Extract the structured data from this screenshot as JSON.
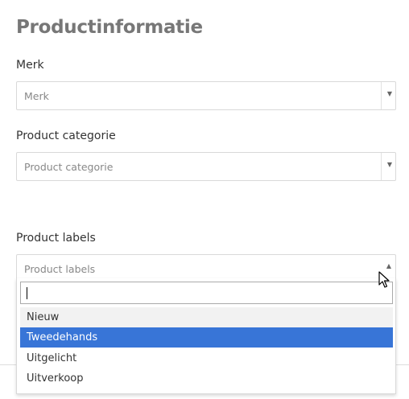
{
  "page": {
    "title": "Productinformatie"
  },
  "fields": {
    "brand": {
      "label": "Merk",
      "placeholder": "Merk"
    },
    "category": {
      "label": "Product categorie",
      "placeholder": "Product categorie"
    },
    "labels": {
      "label": "Product labels",
      "placeholder": "Product labels"
    }
  },
  "dropdown": {
    "search_value": "",
    "options": [
      "Nieuw",
      "Tweedehands",
      "Uitgelicht",
      "Uitverkoop"
    ],
    "hovered_option": "Nieuw",
    "highlighted_option": "Tweedehands"
  },
  "colors": {
    "highlight": "#3875d7",
    "title": "#777777",
    "border": "#d9d9d9"
  },
  "icons": {
    "dropdown_arrow_down": "chevron-down-icon",
    "dropdown_arrow_up": "chevron-up-icon",
    "pointer": "mouse-cursor-icon"
  }
}
